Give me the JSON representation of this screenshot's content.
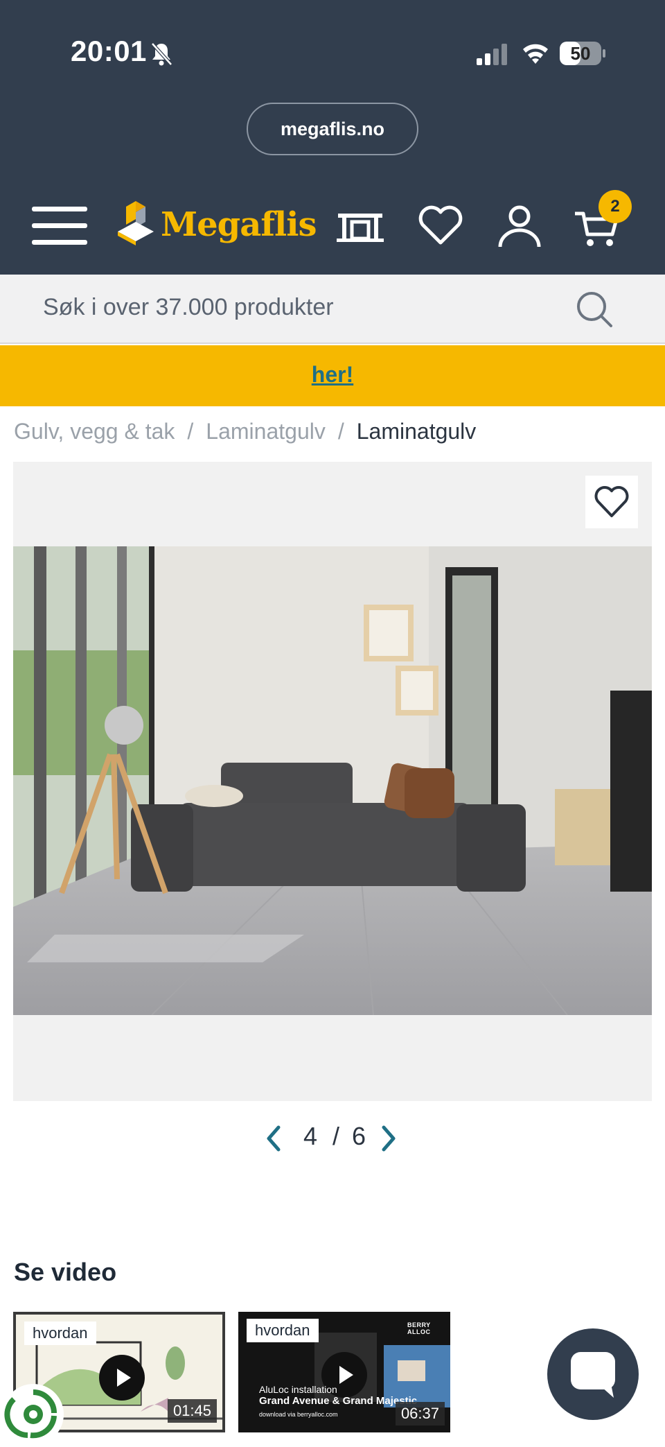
{
  "status_bar": {
    "time": "20:01",
    "battery": "50",
    "battery_level": 0.5
  },
  "browser": {
    "url": "megaflis.no"
  },
  "header": {
    "logo_text": "Megaflis",
    "cart_count": "2",
    "icons": [
      "menu-icon",
      "store-icon",
      "heart-icon",
      "user-icon",
      "cart-icon"
    ]
  },
  "search": {
    "placeholder": "Søk i over 37.000 produkter"
  },
  "banner": {
    "link_text": "her!"
  },
  "breadcrumb": {
    "items": [
      "Gulv, vegg & tak",
      "Laminatgulv",
      "Laminatgulv"
    ],
    "separator": "/"
  },
  "gallery": {
    "current": "4",
    "total": "6",
    "separator": "/"
  },
  "video_section": {
    "title": "Se video",
    "videos": [
      {
        "tag": "hvordan",
        "duration": "01:45"
      },
      {
        "tag": "hvordan",
        "duration": "06:37",
        "caption_line1": "AluLoc installation",
        "caption_line2": "Grand Avenue & Grand Majestic",
        "caption_line3": "download via berryalloc.com",
        "brand": "BERRY ALLOC"
      }
    ]
  },
  "colors": {
    "header_bg": "#323e4e",
    "accent_yellow": "#f6b800",
    "link_teal": "#1f6f85"
  }
}
